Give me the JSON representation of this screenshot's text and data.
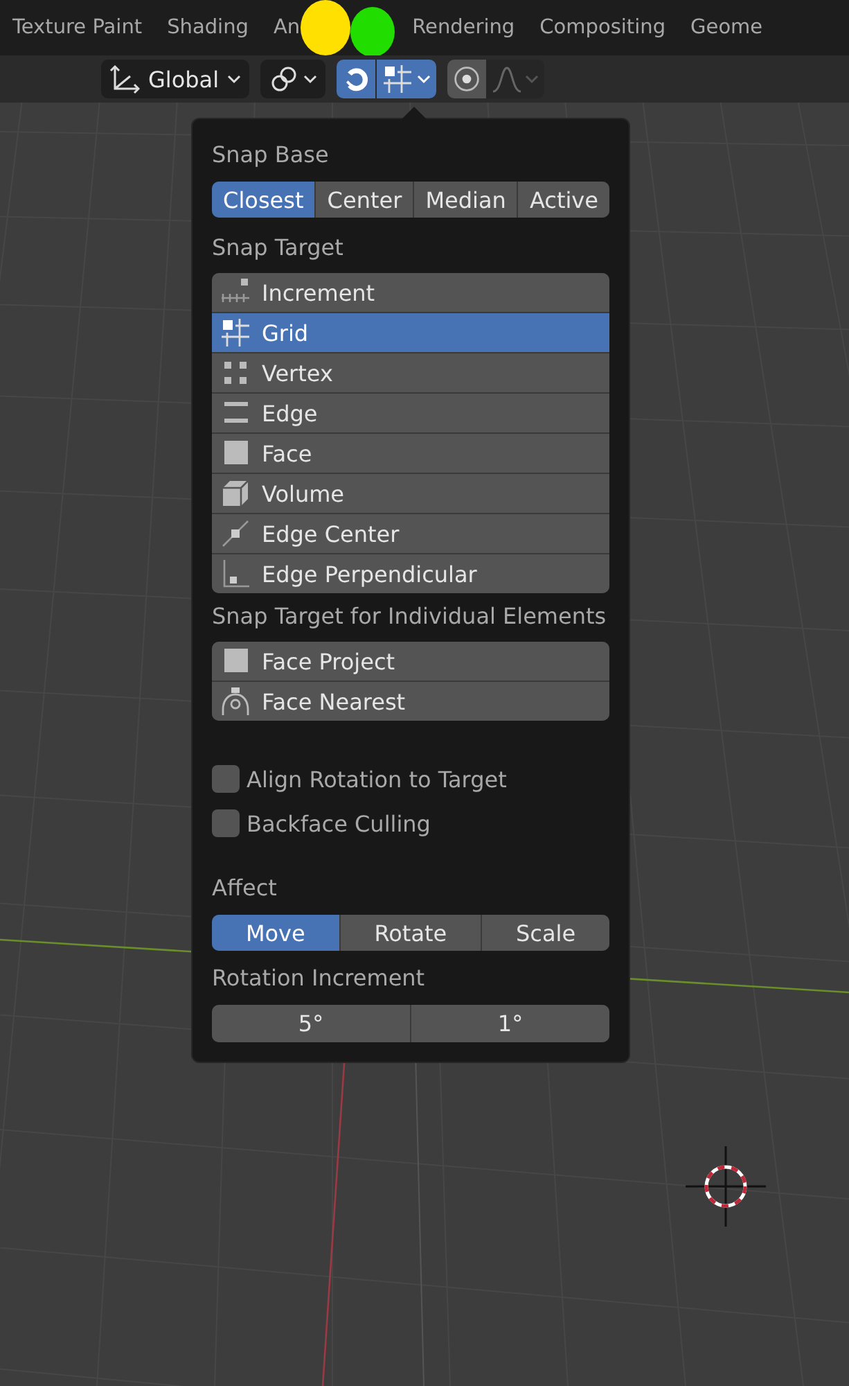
{
  "workspace_tabs": [
    {
      "label": "Texture Paint",
      "selected": false
    },
    {
      "label": "Shading",
      "selected": false
    },
    {
      "label": "An",
      "selected": false
    },
    {
      "label": "Rendering",
      "selected": false
    },
    {
      "label": "Compositing",
      "selected": false
    },
    {
      "label": "Geome",
      "selected": false
    }
  ],
  "annotation_markers": [
    {
      "color": "#ffe000"
    },
    {
      "color": "#22dd00"
    }
  ],
  "toolbar": {
    "orientation": "Global",
    "snap_on": true,
    "proportional_on": false
  },
  "snap_popover": {
    "snap_base_label": "Snap Base",
    "snap_base": [
      {
        "label": "Closest",
        "selected": true
      },
      {
        "label": "Center",
        "selected": false
      },
      {
        "label": "Median",
        "selected": false
      },
      {
        "label": "Active",
        "selected": false
      }
    ],
    "snap_target_label": "Snap Target",
    "snap_target": [
      {
        "label": "Increment",
        "selected": false
      },
      {
        "label": "Grid",
        "selected": true
      },
      {
        "label": "Vertex",
        "selected": false
      },
      {
        "label": "Edge",
        "selected": false
      },
      {
        "label": "Face",
        "selected": false
      },
      {
        "label": "Volume",
        "selected": false
      },
      {
        "label": "Edge Center",
        "selected": false
      },
      {
        "label": "Edge Perpendicular",
        "selected": false
      }
    ],
    "individual_label": "Snap Target for Individual Elements",
    "individual": [
      {
        "label": "Face Project",
        "selected": false
      },
      {
        "label": "Face Nearest",
        "selected": false
      }
    ],
    "options": [
      {
        "label": "Align Rotation to Target",
        "checked": false
      },
      {
        "label": "Backface Culling",
        "checked": false
      }
    ],
    "affect_label": "Affect",
    "affect": [
      {
        "label": "Move",
        "selected": true
      },
      {
        "label": "Rotate",
        "selected": false
      },
      {
        "label": "Scale",
        "selected": false
      }
    ],
    "rotation_label": "Rotation Increment",
    "rotation": [
      {
        "label": "5°"
      },
      {
        "label": "1°"
      }
    ]
  }
}
